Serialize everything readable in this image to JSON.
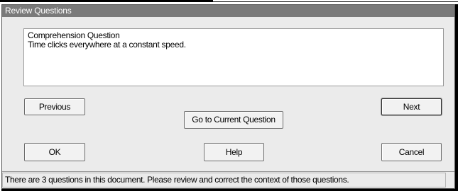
{
  "window": {
    "title": "Review Questions"
  },
  "question_box": {
    "heading": "Comprehension Question",
    "text": "Time clicks everywhere at a constant speed."
  },
  "buttons": {
    "previous": "Previous",
    "go_to_current": "Go to Current Question",
    "next": "Next",
    "ok": "OK",
    "help": "Help",
    "cancel": "Cancel"
  },
  "status_bar": {
    "message": "There are 3 questions in this document. Please review and correct the context of those questions."
  }
}
